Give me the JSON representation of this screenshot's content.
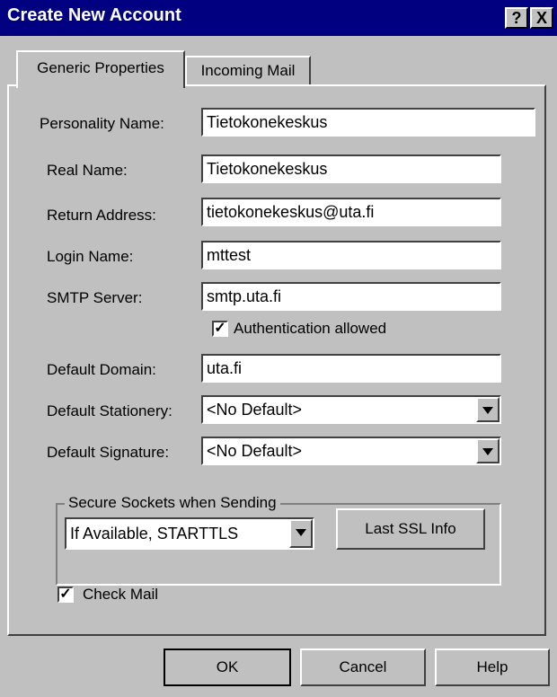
{
  "window": {
    "title": "Create New Account",
    "help_btn": "?",
    "close_btn": "X"
  },
  "tabs": [
    {
      "label": "Generic Properties",
      "active": true
    },
    {
      "label": "Incoming Mail",
      "active": false
    }
  ],
  "form": {
    "personality_label": "Personality Name:",
    "personality_value": "Tietokonekeskus",
    "realname_label": "Real Name:",
    "realname_value": "Tietokonekeskus",
    "return_label": "Return Address:",
    "return_value": "tietokonekeskus@uta.fi",
    "login_label": "Login Name:",
    "login_value": "mttest",
    "smtp_label": "SMTP Server:",
    "smtp_value": "smtp.uta.fi",
    "auth_label": "Authentication allowed",
    "auth_checked": true,
    "domain_label": "Default Domain:",
    "domain_value": "uta.fi",
    "stationery_label": "Default Stationery:",
    "stationery_value": "<No Default>",
    "signature_label": "Default Signature:",
    "signature_value": "<No Default>"
  },
  "ssl": {
    "group_title": "Secure Sockets when Sending",
    "select_value": "If Available, STARTTLS",
    "info_button": "Last SSL Info"
  },
  "checkmail": {
    "label": "Check Mail",
    "checked": true
  },
  "buttons": {
    "ok": "OK",
    "cancel": "Cancel",
    "help": "Help"
  }
}
